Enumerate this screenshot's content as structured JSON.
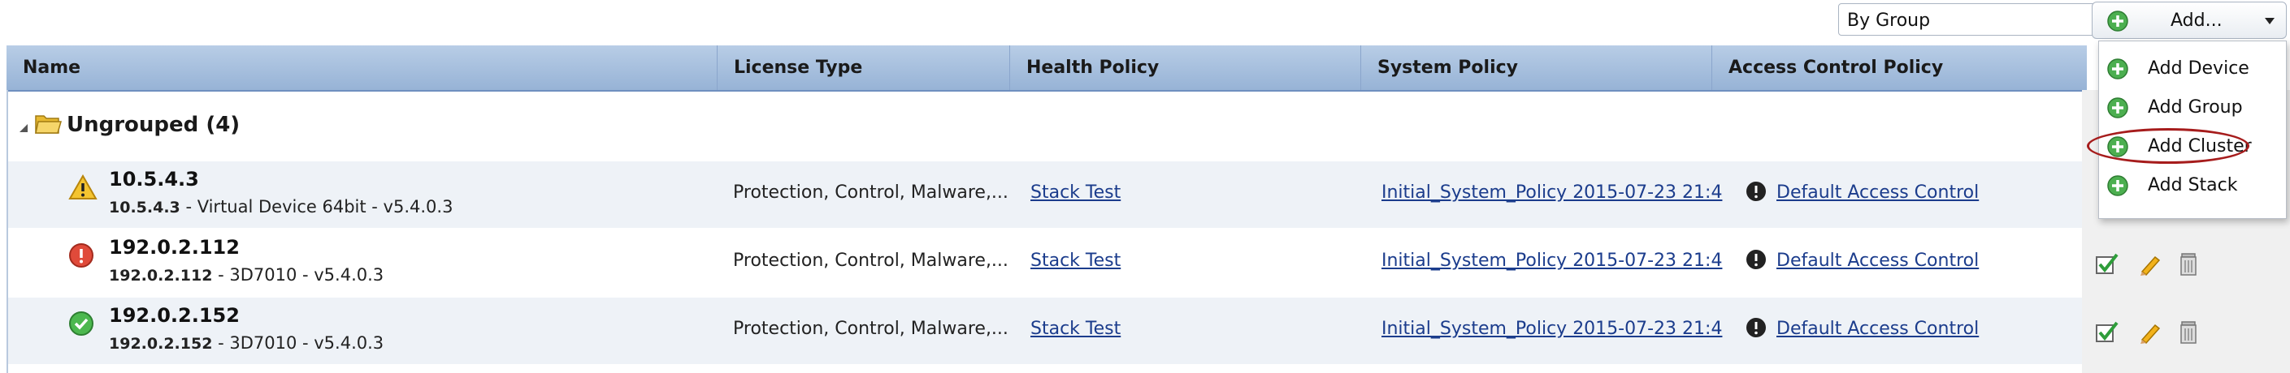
{
  "toolbar": {
    "group_by_value": "By Group",
    "add_label": "Add..."
  },
  "columns": [
    "Name",
    "License Type",
    "Health Policy",
    "System Policy",
    "Access Control Policy"
  ],
  "group": {
    "name": "Ungrouped (4)"
  },
  "devices": [
    {
      "status_icon": "warning-icon",
      "name": "10.5.4.3",
      "sub_ip": "10.5.4.3",
      "sub_desc": " - Virtual Device 64bit - v5.4.0.3",
      "license": "Protection, Control, Malware,...",
      "health_policy": "Stack Test",
      "system_policy": "Initial_System_Policy 2015-07-23 21:4",
      "access_control": "Default Access Control"
    },
    {
      "status_icon": "error-icon",
      "name": "192.0.2.112",
      "sub_ip": "192.0.2.112",
      "sub_desc": "  - 3D7010 - v5.4.0.3",
      "license": "Protection, Control, Malware,...",
      "health_policy": "Stack Test",
      "system_policy": "Initial_System_Policy 2015-07-23 21:4",
      "access_control": "Default Access Control"
    },
    {
      "status_icon": "ok-icon",
      "name": "192.0.2.152",
      "sub_ip": "192.0.2.152",
      "sub_desc": "  - 3D7010 - v5.4.0.3",
      "license": "Protection, Control, Malware,...",
      "health_policy": "Stack Test",
      "system_policy": "Initial_System_Policy 2015-07-23 21:4",
      "access_control": "Default Access Control"
    }
  ],
  "add_menu": {
    "items": [
      "Add Device",
      "Add Group",
      "Add Cluster",
      "Add Stack"
    ],
    "highlighted": "Add Cluster"
  },
  "colors": {
    "header_bg": "#a9c1e1",
    "link": "#1b3c8c",
    "add_green": "#4caf50",
    "highlight_ring": "#a61c1c"
  }
}
